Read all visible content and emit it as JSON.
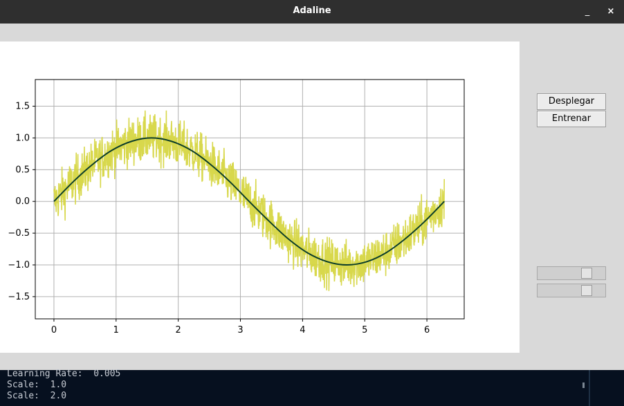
{
  "window": {
    "title": "Adaline",
    "minimize": "_",
    "close": "×"
  },
  "controls": {
    "deploy_label": "Desplegar",
    "train_label": "Entrenar"
  },
  "sliders": [
    {
      "name": "learning-rate",
      "value": 0.005,
      "position_fraction": 0.77
    },
    {
      "name": "scale",
      "value": 2.0,
      "position_fraction": 0.77
    }
  ],
  "terminal": {
    "lines": [
      "Learning Rate:  0.005",
      "Scale:  1.0",
      "Scale:  2.0"
    ]
  },
  "colors": {
    "noisy": "#d6d642",
    "clean": "#0b3d2a",
    "grid": "#b0b0b0"
  },
  "chart_data": {
    "type": "line",
    "title": "",
    "xlabel": "",
    "ylabel": "",
    "xlim": [
      -0.3,
      6.6
    ],
    "ylim": [
      -1.85,
      1.92
    ],
    "xticks": [
      0,
      1,
      2,
      3,
      4,
      5,
      6
    ],
    "yticks": [
      1.5,
      1.0,
      0.5,
      0.0,
      -0.5,
      -1.0,
      -1.5
    ],
    "ytick_labels": [
      "1.5",
      "1.0",
      "0.5",
      "0.0",
      "−0.5",
      "−1.0",
      "−1.5"
    ],
    "grid": true,
    "series": [
      {
        "style": "noisy",
        "color": "#d6d642",
        "x": [
          0.0,
          0.31,
          0.63,
          0.94,
          1.26,
          1.57,
          1.88,
          2.2,
          2.51,
          2.83,
          3.14,
          3.46,
          3.77,
          4.08,
          4.4,
          4.71,
          5.03,
          5.34,
          5.65,
          5.97,
          6.28
        ],
        "y": [
          0.0,
          0.31,
          0.59,
          0.81,
          0.95,
          1.0,
          0.95,
          0.81,
          0.59,
          0.31,
          0.0,
          -0.31,
          -0.59,
          -0.81,
          -0.95,
          -1.0,
          -0.95,
          -0.81,
          -0.59,
          -0.31,
          0.0
        ],
        "noise_amplitude": 0.35
      },
      {
        "style": "clean",
        "color": "#0b3d2a",
        "x": [
          0.0,
          0.31,
          0.63,
          0.94,
          1.26,
          1.57,
          1.88,
          2.2,
          2.51,
          2.83,
          3.14,
          3.46,
          3.77,
          4.08,
          4.4,
          4.71,
          5.03,
          5.34,
          5.65,
          5.97,
          6.28
        ],
        "y": [
          0.0,
          0.31,
          0.59,
          0.81,
          0.95,
          1.0,
          0.95,
          0.81,
          0.59,
          0.31,
          0.0,
          -0.31,
          -0.59,
          -0.81,
          -0.95,
          -1.0,
          -0.95,
          -0.81,
          -0.59,
          -0.31,
          0.0
        ]
      }
    ]
  }
}
